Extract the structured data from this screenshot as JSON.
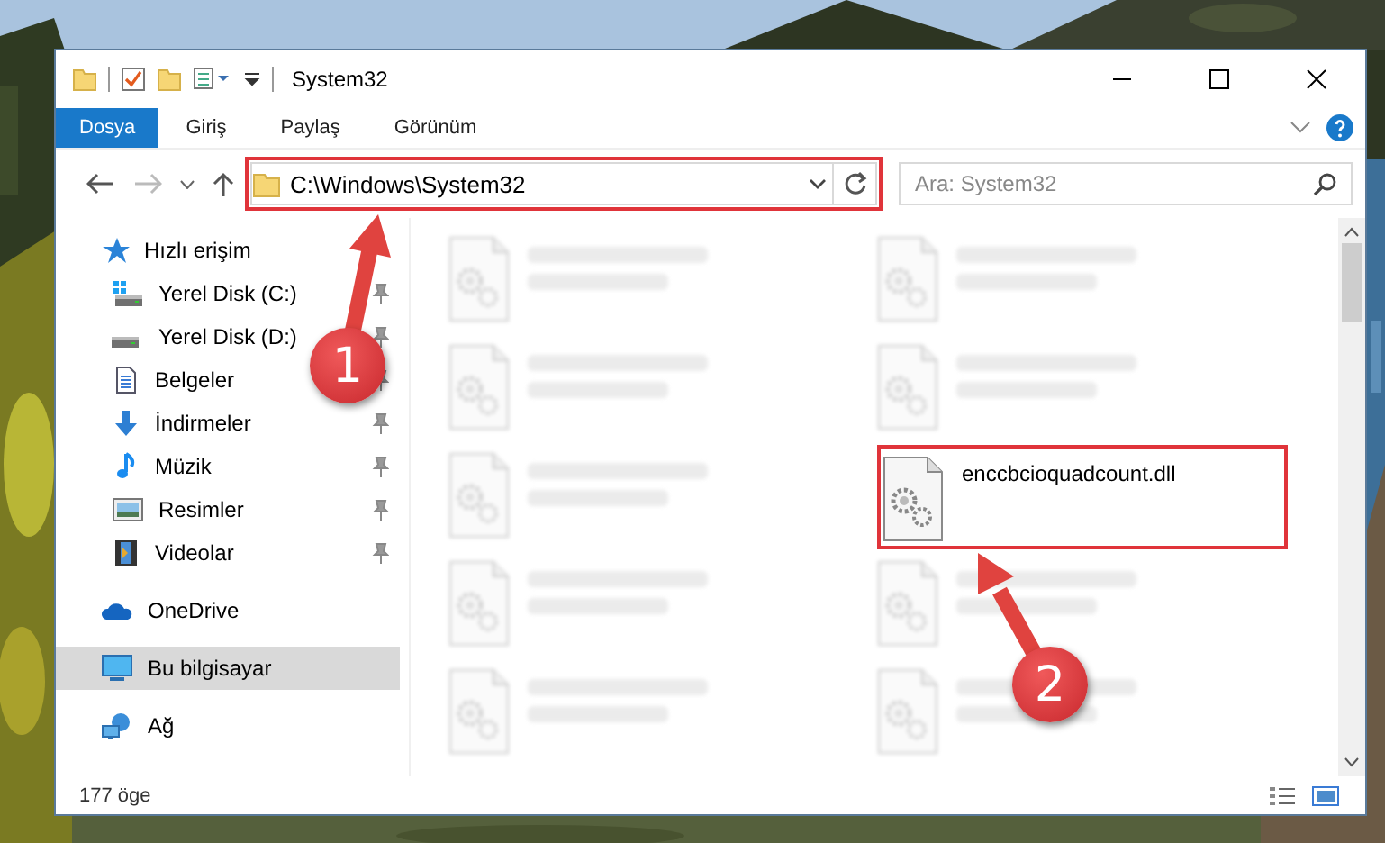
{
  "window": {
    "title": "System32"
  },
  "ribbon": {
    "tabs": [
      {
        "label": "Dosya",
        "selected": true
      },
      {
        "label": "Giriş",
        "selected": false
      },
      {
        "label": "Paylaş",
        "selected": false
      },
      {
        "label": "Görünüm",
        "selected": false
      }
    ]
  },
  "address_bar": {
    "path": "C:\\Windows\\System32",
    "highlighted": true
  },
  "search": {
    "placeholder": "Ara: System32"
  },
  "sidebar": {
    "items": [
      {
        "label": "Hızlı erişim",
        "kind": "star",
        "selected": false,
        "children": [
          {
            "label": "Yerel Disk (C:)",
            "kind": "systemdrive",
            "pinned": true,
            "selected": false
          },
          {
            "label": "Yerel Disk (D:)",
            "kind": "drive",
            "pinned": true,
            "selected": false
          },
          {
            "label": "Belgeler",
            "kind": "document",
            "pinned": true,
            "selected": false
          },
          {
            "label": "İndirmeler",
            "kind": "download",
            "pinned": true,
            "selected": false
          },
          {
            "label": "Müzik",
            "kind": "music",
            "pinned": true,
            "selected": false
          },
          {
            "label": "Resimler",
            "kind": "pictures",
            "pinned": true,
            "selected": false
          },
          {
            "label": "Videolar",
            "kind": "videos",
            "pinned": true,
            "selected": false
          }
        ]
      },
      {
        "label": "OneDrive",
        "kind": "cloud",
        "selected": false
      },
      {
        "label": "Bu bilgisayar",
        "kind": "computer",
        "selected": true
      },
      {
        "label": "Ağ",
        "kind": "network",
        "selected": false
      }
    ]
  },
  "files": [
    {
      "blurred": true,
      "highlighted": false
    },
    {
      "blurred": true,
      "highlighted": false
    },
    {
      "blurred": true,
      "highlighted": false
    },
    {
      "blurred": true,
      "highlighted": false
    },
    {
      "blurred": true,
      "highlighted": false
    },
    {
      "name": "enccbcioquadcount.dll",
      "blurred": false,
      "highlighted": true
    },
    {
      "blurred": true,
      "highlighted": false
    },
    {
      "blurred": true,
      "highlighted": false
    },
    {
      "blurred": true,
      "highlighted": false
    },
    {
      "blurred": true,
      "highlighted": false
    }
  ],
  "status_bar": {
    "count": "177 öge"
  },
  "annotations": [
    {
      "label": "1"
    },
    {
      "label": "2"
    }
  ]
}
